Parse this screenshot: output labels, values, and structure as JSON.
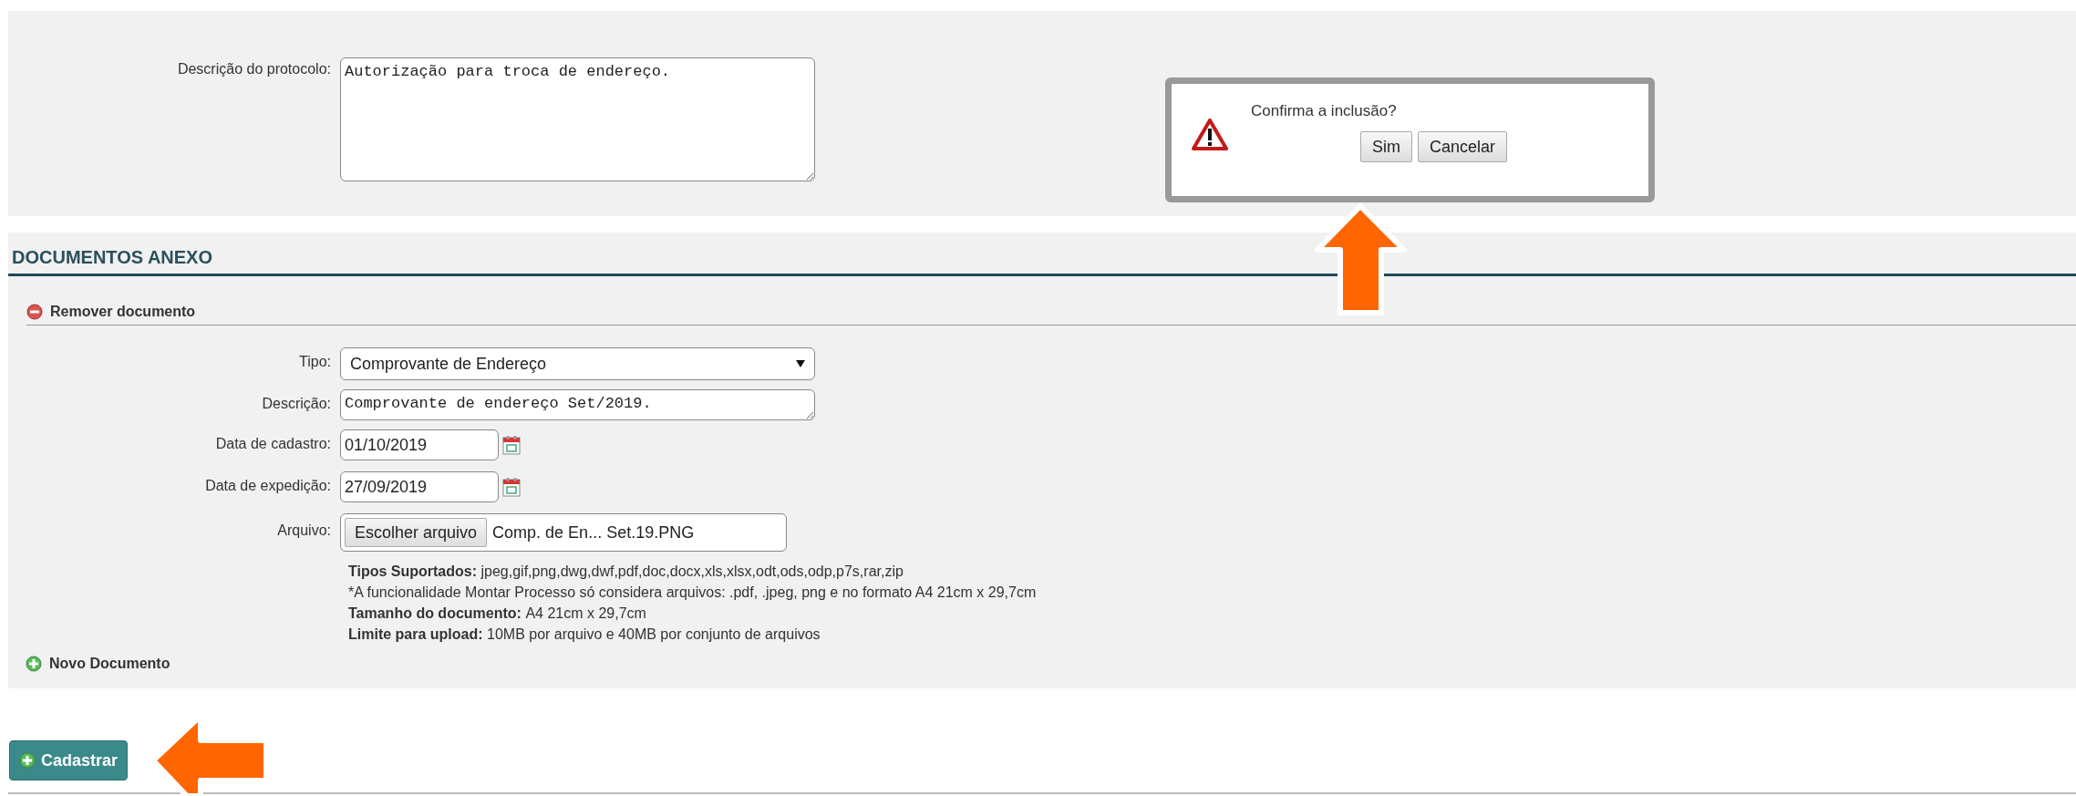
{
  "protocol": {
    "label": "Descrição do protocolo:",
    "value": "Autorização para troca de endereço."
  },
  "dialog": {
    "message": "Confirma a inclusão?",
    "buttons": [
      "Sim",
      "Cancelar"
    ]
  },
  "attachments": {
    "title": "DOCUMENTOS ANEXO",
    "remove_label": "Remover documento",
    "fields": [
      {
        "kind": "select",
        "label": "Tipo:",
        "value": "Comprovante de Endereço"
      },
      {
        "kind": "textarea",
        "label": "Descrição:",
        "value": "Comprovante de endereço Set/2019."
      },
      {
        "kind": "date",
        "label": "Data de cadastro:",
        "value": "01/10/2019"
      },
      {
        "kind": "date",
        "label": "Data de expedição:",
        "value": "27/09/2019"
      },
      {
        "kind": "file",
        "label": "Arquivo:",
        "button": "Escolher arquivo",
        "value": "Comp. de En... Set.19.PNG"
      }
    ],
    "notes": [
      {
        "label": "Tipos Suportados:",
        "text": "jpeg,gif,png,dwg,dwf,pdf,doc,docx,xls,xlsx,odt,ods,odp,p7s,rar,zip"
      },
      {
        "text": "*A funcionalidade Montar Processo só considera arquivos: .pdf, .jpeg, png e no formato A4 21cm x 29,7cm"
      },
      {
        "label": "Tamanho do documento:",
        "text": "A4 21cm x 29,7cm"
      },
      {
        "label": "Limite para upload:",
        "text": "10MB por arquivo e 40MB por conjunto de arquivos"
      }
    ],
    "add_label": "Novo Documento"
  },
  "submit": "Cadastrar",
  "callouts": [
    {
      "kind": "up-arrow"
    },
    {
      "kind": "left-arrow"
    }
  ]
}
